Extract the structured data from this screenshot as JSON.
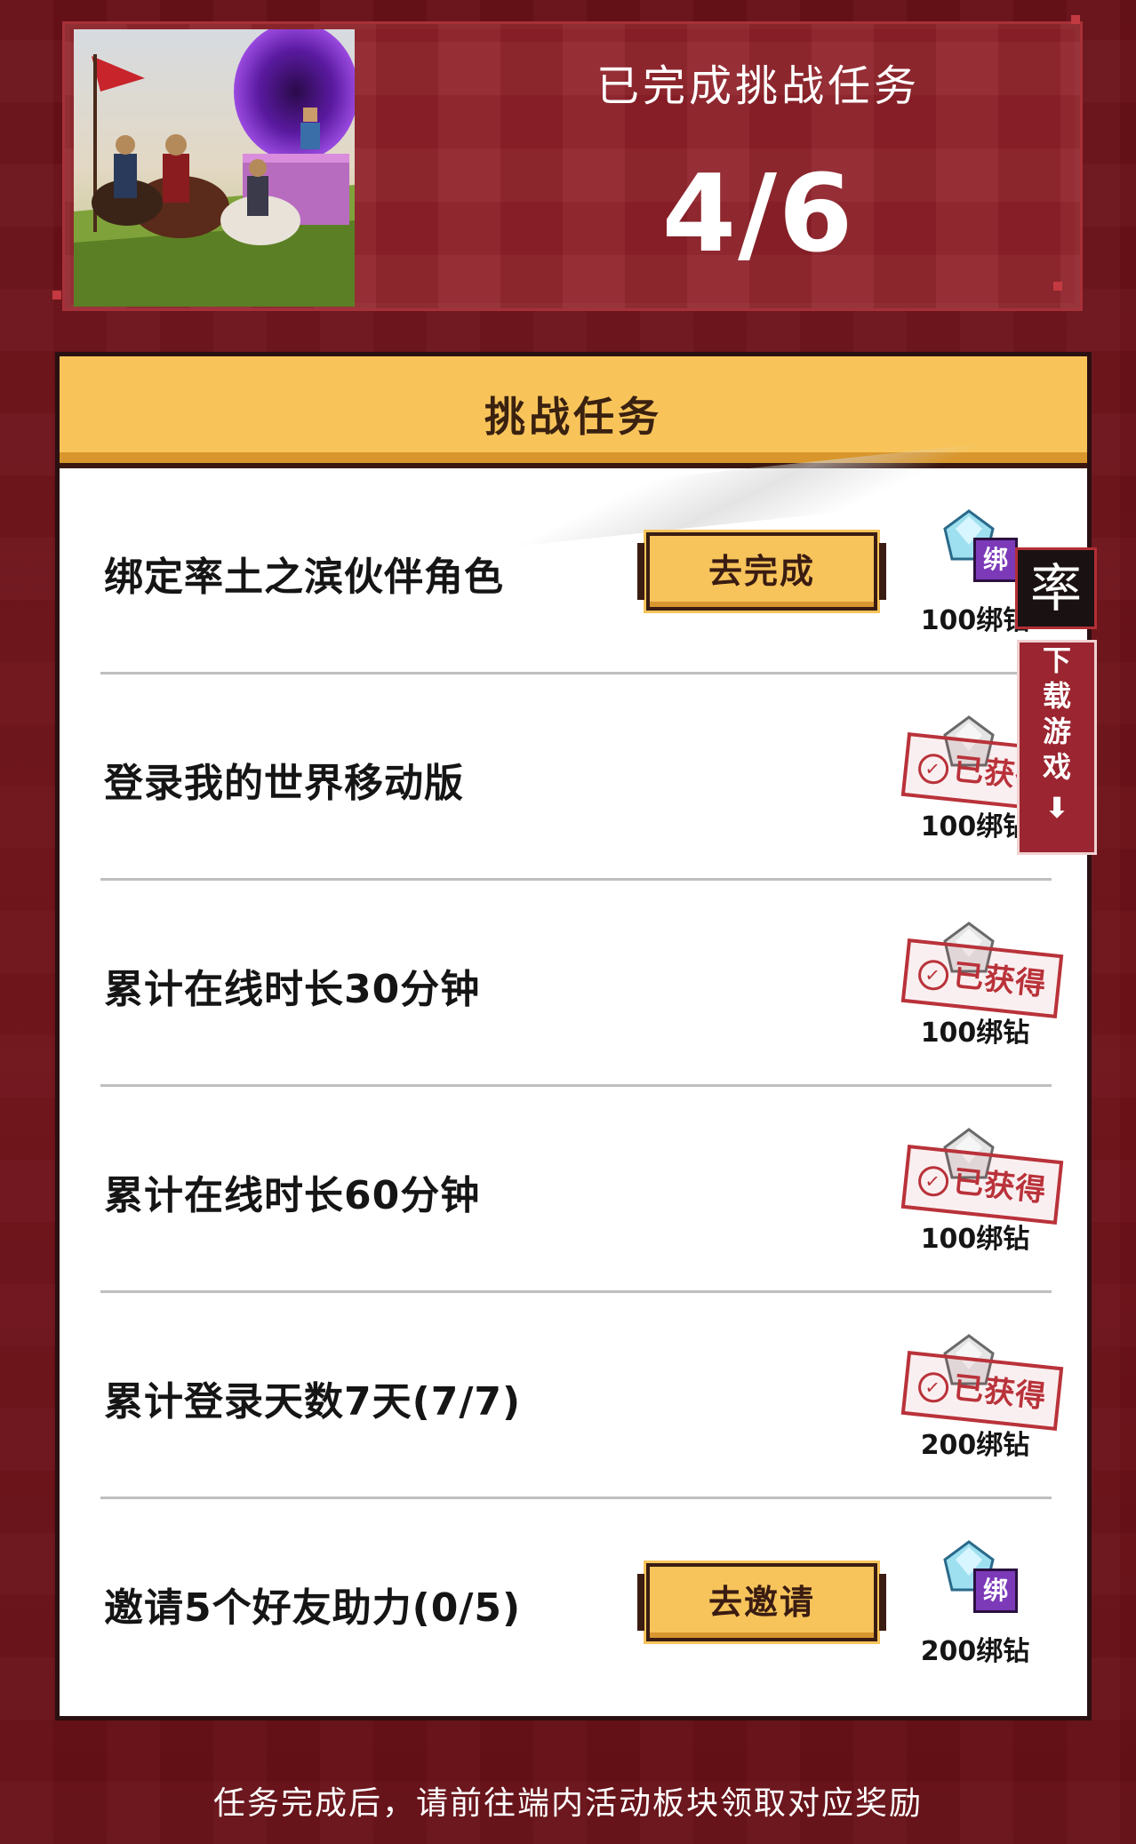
{
  "header": {
    "title": "已完成挑战任务",
    "progress": "4/6"
  },
  "panel": {
    "title": "挑战任务"
  },
  "tasks": [
    {
      "name": "绑定率土之滨伙伴角色",
      "action": "去完成",
      "reward": "100绑钻",
      "claimed": false
    },
    {
      "name": "登录我的世界移动版",
      "action": "",
      "reward": "100绑钻",
      "claimed": true
    },
    {
      "name": "累计在线时长30分钟",
      "action": "",
      "reward": "100绑钻",
      "claimed": true
    },
    {
      "name": "累计在线时长60分钟",
      "action": "",
      "reward": "100绑钻",
      "claimed": true
    },
    {
      "name": "累计登录天数7天(7/7)",
      "action": "",
      "reward": "200绑钻",
      "claimed": true
    },
    {
      "name": "邀请5个好友助力(0/5)",
      "action": "去邀请",
      "reward": "200绑钻",
      "claimed": false
    }
  ],
  "labels": {
    "claimed_stamp": "已获得",
    "bind_badge": "绑"
  },
  "side": {
    "icon_glyph": "率",
    "download_chars": [
      "下",
      "载",
      "游",
      "戏"
    ]
  },
  "footer": {
    "note": "任务完成后，请前往端内活动板块领取对应奖励"
  },
  "colors": {
    "primary_red": "#8e2028",
    "gold": "#f8c45a",
    "stamp_red": "#b9323a"
  }
}
